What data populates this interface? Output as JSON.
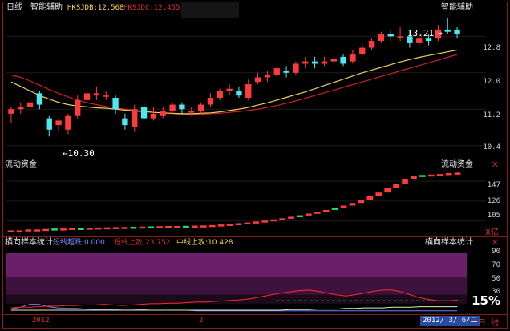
{
  "main": {
    "period": "日线",
    "indicator": "智能辅助",
    "hksjdb": "HKSJDB:12.568",
    "hksjdc": "HKSJDC:12.455",
    "right_title": "智能辅助",
    "high_label": "13.21",
    "low_label": "10.30",
    "yticks": [
      "12.8",
      "12.0",
      "11.2",
      "10.4"
    ]
  },
  "flow": {
    "title": "流动资金",
    "right_title": "流动资金",
    "unit": "X亿",
    "yticks": [
      "147",
      "126",
      "105"
    ]
  },
  "sample": {
    "title": "横向样本统计",
    "short_down": "短线超跌:0.000",
    "short_up": "短线上攻:23.752",
    "mid_up": "中线上攻:10.428",
    "right_title": "横向样本统计",
    "yticks": [
      "90",
      "70",
      "50",
      "30"
    ],
    "percent": "15%"
  },
  "footer": {
    "year": "2012",
    "month": "2",
    "date": "2012/ 3/ 6/二",
    "period_short": "日",
    "mode": "线"
  },
  "chart_data": [
    {
      "type": "candlestick",
      "ylim": [
        10.2,
        13.3
      ],
      "candles": [
        [
          11.1,
          11.2,
          10.9,
          11.25
        ],
        [
          11.2,
          11.25,
          11.1,
          11.35
        ],
        [
          11.25,
          11.35,
          11.15,
          11.45
        ],
        [
          11.55,
          11.3,
          11.2,
          11.6
        ],
        [
          11.0,
          10.75,
          10.6,
          11.05
        ],
        [
          10.85,
          10.95,
          10.7,
          11.0
        ],
        [
          10.75,
          11.05,
          10.65,
          11.1
        ],
        [
          11.05,
          11.4,
          11.0,
          11.5
        ],
        [
          11.4,
          11.55,
          11.3,
          11.7
        ],
        [
          11.5,
          11.55,
          11.4,
          11.7
        ],
        [
          11.5,
          11.5,
          11.4,
          11.6
        ],
        [
          11.45,
          11.2,
          11.1,
          11.5
        ],
        [
          11.0,
          10.85,
          10.75,
          11.1
        ],
        [
          10.8,
          11.2,
          10.7,
          11.3
        ],
        [
          11.25,
          11.0,
          10.95,
          11.35
        ],
        [
          11.0,
          11.1,
          10.95,
          11.25
        ],
        [
          11.05,
          11.15,
          11.0,
          11.25
        ],
        [
          11.15,
          11.3,
          11.1,
          11.35
        ],
        [
          11.3,
          11.2,
          11.1,
          11.35
        ],
        [
          11.15,
          11.15,
          11.05,
          11.25
        ],
        [
          11.15,
          11.3,
          11.1,
          11.35
        ],
        [
          11.3,
          11.45,
          11.25,
          11.55
        ],
        [
          11.45,
          11.6,
          11.4,
          11.65
        ],
        [
          11.6,
          11.65,
          11.5,
          11.75
        ],
        [
          11.6,
          11.5,
          11.45,
          11.7
        ],
        [
          11.45,
          11.75,
          11.4,
          11.85
        ],
        [
          11.8,
          11.9,
          11.75,
          12.0
        ],
        [
          11.9,
          11.95,
          11.8,
          12.05
        ],
        [
          11.95,
          12.1,
          11.9,
          12.15
        ],
        [
          12.05,
          12.0,
          11.9,
          12.15
        ],
        [
          12.0,
          12.2,
          11.95,
          12.25
        ],
        [
          12.2,
          12.25,
          12.1,
          12.35
        ],
        [
          12.25,
          12.2,
          12.1,
          12.35
        ],
        [
          12.2,
          12.25,
          12.15,
          12.35
        ],
        [
          12.25,
          12.3,
          12.2,
          12.35
        ],
        [
          12.35,
          12.2,
          12.15,
          12.4
        ],
        [
          12.25,
          12.4,
          12.2,
          12.5
        ],
        [
          12.4,
          12.55,
          12.35,
          12.65
        ],
        [
          12.55,
          12.7,
          12.5,
          12.75
        ],
        [
          12.7,
          12.85,
          12.65,
          12.9
        ],
        [
          12.85,
          12.8,
          12.7,
          12.95
        ],
        [
          12.8,
          12.8,
          12.7,
          13.0
        ],
        [
          12.8,
          12.65,
          12.55,
          12.95
        ],
        [
          12.65,
          12.75,
          12.6,
          12.85
        ],
        [
          12.75,
          12.7,
          12.6,
          12.85
        ],
        [
          12.75,
          12.95,
          12.7,
          13.05
        ],
        [
          12.95,
          12.9,
          12.85,
          13.21
        ],
        [
          12.95,
          12.85,
          12.75,
          13.0
        ]
      ],
      "ma_yellow": [
        11.8,
        11.7,
        11.6,
        11.5,
        11.42,
        11.35,
        11.3,
        11.27,
        11.25,
        11.23,
        11.22,
        11.2,
        11.18,
        11.16,
        11.15,
        11.13,
        11.12,
        11.11,
        11.1,
        11.1,
        11.11,
        11.12,
        11.14,
        11.17,
        11.2,
        11.24,
        11.29,
        11.34,
        11.4,
        11.46,
        11.52,
        11.58,
        11.65,
        11.72,
        11.79,
        11.86,
        11.93,
        12.0,
        12.06,
        12.12,
        12.18,
        12.24,
        12.29,
        12.34,
        12.38,
        12.42,
        12.46,
        12.5
      ],
      "ma_red": [
        11.95,
        11.9,
        11.82,
        11.73,
        11.63,
        11.55,
        11.47,
        11.4,
        11.34,
        11.3,
        11.26,
        11.23,
        11.2,
        11.18,
        11.15,
        11.13,
        11.12,
        11.1,
        11.09,
        11.09,
        11.09,
        11.1,
        11.11,
        11.13,
        11.15,
        11.17,
        11.2,
        11.24,
        11.28,
        11.33,
        11.38,
        11.44,
        11.5,
        11.56,
        11.62,
        11.68,
        11.74,
        11.8,
        11.86,
        11.92,
        11.98,
        12.04,
        12.1,
        12.16,
        12.22,
        12.28,
        12.34,
        12.4
      ]
    },
    {
      "type": "bar",
      "ylim": [
        92,
        158
      ],
      "values": [
        95,
        95,
        96,
        96,
        96.5,
        97,
        97,
        97.5,
        97.5,
        97.8,
        98,
        98.2,
        98.4,
        98.6,
        98.8,
        99,
        99.2,
        99.4,
        99.6,
        99.6,
        99.8,
        100,
        100.2,
        100.6,
        101.2,
        101.8,
        102.6,
        103.4,
        104.4,
        105.4,
        106.6,
        107.8,
        109.4,
        111,
        112.8,
        114.6,
        116.6,
        118.8,
        121.2,
        124,
        127.2,
        131,
        135,
        139.5,
        144.5,
        149.5,
        152.5,
        153.5,
        154,
        154.5,
        155.5,
        156
      ],
      "colors": [
        "r",
        "r",
        "r",
        "r",
        "r",
        "g",
        "r",
        "r",
        "g",
        "r",
        "r",
        "r",
        "r",
        "r",
        "g",
        "r",
        "g",
        "r",
        "r",
        "r",
        "g",
        "r",
        "r",
        "r",
        "r",
        "r",
        "r",
        "r",
        "r",
        "r",
        "r",
        "r",
        "r",
        "g",
        "r",
        "r",
        "r",
        "g",
        "r",
        "r",
        "r",
        "r",
        "r",
        "r",
        "r",
        "r",
        "r",
        "g",
        "r",
        "r",
        "r",
        "r"
      ]
    },
    {
      "type": "line",
      "ylim": [
        0,
        100
      ],
      "series_red": [
        8,
        9,
        9,
        10,
        11,
        11,
        12,
        12,
        13,
        13,
        14,
        13,
        12,
        13,
        14,
        15,
        15,
        16,
        16,
        17,
        18,
        18,
        19,
        20,
        21,
        22,
        24,
        27,
        30,
        33,
        35,
        37,
        38,
        36,
        33,
        30,
        28,
        30,
        33,
        36,
        38,
        38,
        35,
        30,
        25,
        22,
        20,
        20,
        21
      ],
      "series_white": [
        4,
        4,
        4,
        4,
        4,
        4,
        4,
        4,
        4,
        4,
        4,
        4,
        4,
        4,
        4,
        4,
        4,
        4,
        4,
        4,
        4,
        4,
        4,
        4,
        4,
        4,
        4,
        4,
        4,
        4,
        5,
        5,
        5,
        6,
        6,
        6,
        7,
        7,
        8,
        8,
        8,
        9,
        9,
        9,
        10,
        10,
        10,
        10,
        10
      ],
      "series_blue": [
        6,
        9,
        14,
        14,
        10,
        8,
        7,
        7,
        6,
        5,
        5,
        5,
        6,
        6,
        5,
        4,
        4,
        4,
        4,
        4,
        3,
        3,
        3,
        3,
        3,
        3,
        3,
        3,
        3,
        3,
        3,
        3,
        3,
        3,
        3,
        3,
        3,
        3,
        3,
        3,
        3,
        3,
        3,
        3,
        3,
        3,
        3,
        3,
        3
      ]
    }
  ]
}
